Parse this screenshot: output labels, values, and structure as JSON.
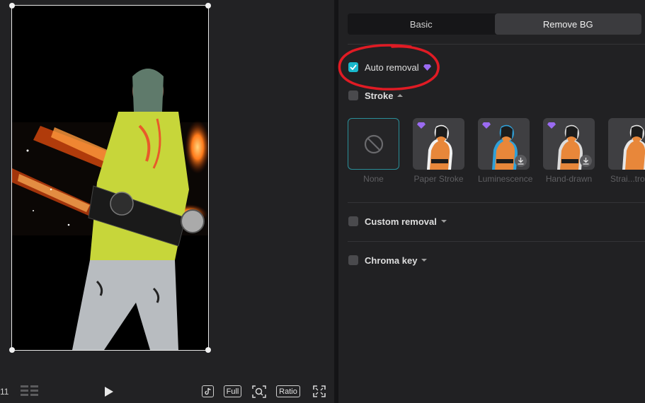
{
  "preview": {
    "frame_number": "11",
    "buttons": {
      "full_label": "Full",
      "ratio_label": "Ratio"
    },
    "icons": [
      "timeline-strip-icon",
      "play-icon",
      "tiktok-icon",
      "zoom-fit-icon",
      "fullscreen-icon"
    ]
  },
  "panel": {
    "tabs": [
      {
        "label": "Basic",
        "active": false
      },
      {
        "label": "Remove BG",
        "active": true
      }
    ],
    "auto_removal": {
      "label": "Auto removal",
      "checked": true,
      "premium": true
    },
    "stroke": {
      "label": "Stroke",
      "checked": false,
      "expanded": true,
      "options": [
        {
          "label": "None",
          "selected": true
        },
        {
          "label": "Paper Stroke",
          "premium": true,
          "download": false
        },
        {
          "label": "Luminescence",
          "premium": true,
          "download": true
        },
        {
          "label": "Hand-drawn",
          "premium": true,
          "download": true
        },
        {
          "label": "Strai...tro",
          "premium": false,
          "download": false
        }
      ]
    },
    "custom_removal": {
      "label": "Custom removal",
      "checked": false
    },
    "chroma_key": {
      "label": "Chroma key",
      "checked": false
    }
  },
  "colors": {
    "accent": "#19b8cc",
    "annotation": "#e01b24",
    "premium": "#9b6bf2"
  }
}
